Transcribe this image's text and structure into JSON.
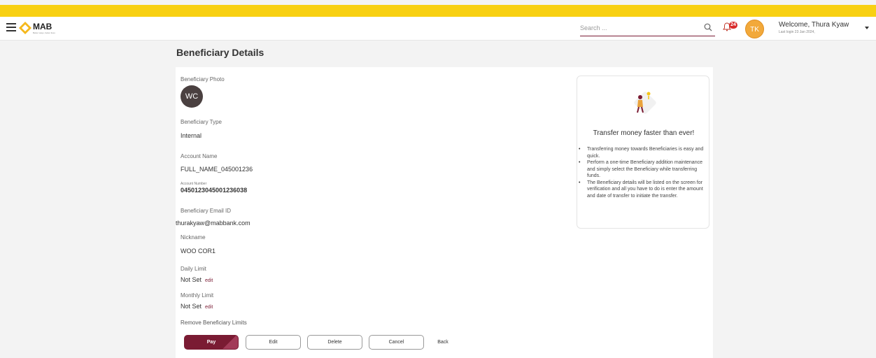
{
  "header": {
    "logo_text": "MAB",
    "logo_tagline": "Better ways, better lives",
    "search_placeholder": "Search ...",
    "notification_count": "24",
    "avatar_initials": "TK",
    "welcome": "Welcome, Thura Kyaw",
    "last_login": "Last login 23 Jan 2024,"
  },
  "page": {
    "title": "Beneficiary Details"
  },
  "details": {
    "photo_label": "Beneficiary Photo",
    "photo_initials": "WC",
    "type_label": "Beneficiary Type",
    "type_value": "Internal",
    "account_name_label": "Account Name",
    "account_name_value": "FULL_NAME_045001236",
    "account_number_label": "Account Number",
    "account_number_value": "045012304500123603 8",
    "email_label": "Beneficiary Email ID",
    "email_value": "thurakyaw@mabbank.com",
    "nickname_label": "Nickname",
    "nickname_value": "WOO COR1",
    "daily_limit_label": "Daily Limit",
    "daily_limit_value": "Not Set",
    "monthly_limit_label": "Monthly Limit",
    "monthly_limit_value": "Not Set",
    "edit_link": "edit",
    "remove_limits": "Remove Beneficiary Limits"
  },
  "actions": {
    "pay": "Pay",
    "edit": "Edit",
    "delete": "Delete",
    "cancel": "Cancel",
    "back": "Back"
  },
  "info_panel": {
    "title": "Transfer money faster than ever!",
    "points": [
      "Transferring money towards Beneficiaries is easy and quick.",
      "Perform a one-time Beneficiary addition maintenance and simply select the Beneficiary while transferring funds.",
      "The Beneficiary details will be listed on the screen for verification and all you have to do is enter the amount and date of transfer to initiate the transfer."
    ]
  },
  "colors": {
    "top_bar": "#f8d012",
    "brand": "#7a1b33",
    "badge": "#d92b2b",
    "avatar": "#f2a93b"
  },
  "icons": [
    "menu-icon",
    "mab-logo-icon",
    "search-icon",
    "bell-icon",
    "caret-down-icon",
    "transfer-illustration-icon"
  ]
}
